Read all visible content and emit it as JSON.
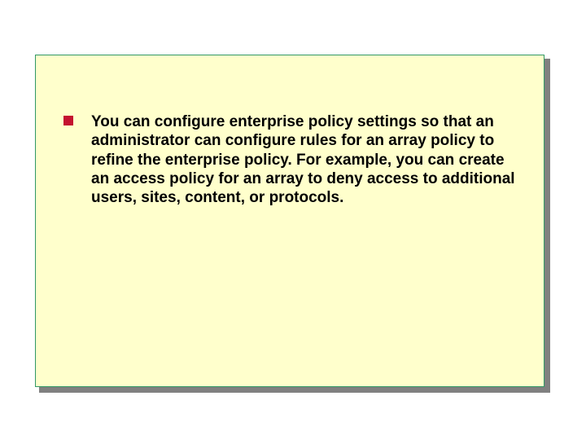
{
  "slide": {
    "bullets": [
      {
        "text": "You can configure enterprise policy settings so that an administrator can configure rules for an array policy to refine the enterprise policy. For example, you can create an access policy for an array to deny access to additional users, sites, content, or protocols."
      }
    ]
  }
}
